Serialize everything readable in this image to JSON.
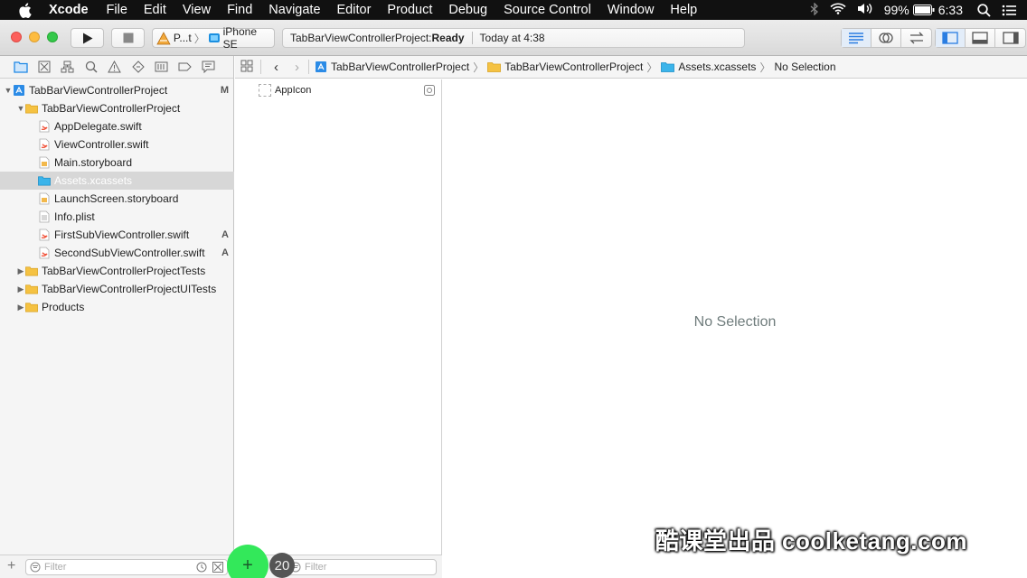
{
  "menubar": {
    "app_name": "Xcode",
    "items": [
      "File",
      "Edit",
      "View",
      "Find",
      "Navigate",
      "Editor",
      "Product",
      "Debug",
      "Source Control",
      "Window",
      "Help"
    ],
    "battery": "99%",
    "time": "6:33"
  },
  "toolbar": {
    "scheme_name": "P...t",
    "device": "iPhone SE",
    "status_project": "TabBarViewControllerProject: ",
    "status_state": "Ready",
    "status_time": "Today at 4:38"
  },
  "navigator": {
    "tree": [
      {
        "label": "TabBarViewControllerProject",
        "badge": "M",
        "icon": "project-icon",
        "disclosure": "open",
        "indent": 0
      },
      {
        "label": "TabBarViewControllerProject",
        "badge": "",
        "icon": "folder-icon",
        "disclosure": "open",
        "indent": 1
      },
      {
        "label": "AppDelegate.swift",
        "badge": "",
        "icon": "swift-file-icon",
        "disclosure": "",
        "indent": 2
      },
      {
        "label": "ViewController.swift",
        "badge": "",
        "icon": "swift-file-icon",
        "disclosure": "",
        "indent": 2
      },
      {
        "label": "Main.storyboard",
        "badge": "",
        "icon": "storyboard-icon",
        "disclosure": "",
        "indent": 2
      },
      {
        "label": "Assets.xcassets",
        "badge": "",
        "icon": "asset-catalog-icon",
        "disclosure": "",
        "indent": 2,
        "selected": true
      },
      {
        "label": "LaunchScreen.storyboard",
        "badge": "",
        "icon": "storyboard-icon",
        "disclosure": "",
        "indent": 2
      },
      {
        "label": "Info.plist",
        "badge": "",
        "icon": "plist-icon",
        "disclosure": "",
        "indent": 2
      },
      {
        "label": "FirstSubViewController.swift",
        "badge": "A",
        "icon": "swift-file-icon",
        "disclosure": "",
        "indent": 2
      },
      {
        "label": "SecondSubViewController.swift",
        "badge": "A",
        "icon": "swift-file-icon",
        "disclosure": "",
        "indent": 2
      },
      {
        "label": "TabBarViewControllerProjectTests",
        "badge": "",
        "icon": "folder-icon",
        "disclosure": "closed",
        "indent": 1
      },
      {
        "label": "TabBarViewControllerProjectUITests",
        "badge": "",
        "icon": "folder-icon",
        "disclosure": "closed",
        "indent": 1
      },
      {
        "label": "Products",
        "badge": "",
        "icon": "folder-icon",
        "disclosure": "closed",
        "indent": 1
      }
    ],
    "filter_placeholder": "Filter"
  },
  "jumpbar": {
    "crumbs": [
      "TabBarViewControllerProject",
      "TabBarViewControllerProject",
      "Assets.xcassets",
      "No Selection"
    ]
  },
  "asset_list": {
    "items": [
      "AppIcon"
    ],
    "filter_placeholder": "Filter"
  },
  "editor": {
    "empty_message": "No Selection",
    "watermark": "酷课堂出品 coolketang.com"
  },
  "overlay": {
    "click_count": "20",
    "add_symbol": "+"
  },
  "colors": {
    "selection": "#d7d7d7",
    "folder": "#f5c242",
    "accent_blue": "#1e88e5",
    "click_indicator": "#33e85a"
  }
}
